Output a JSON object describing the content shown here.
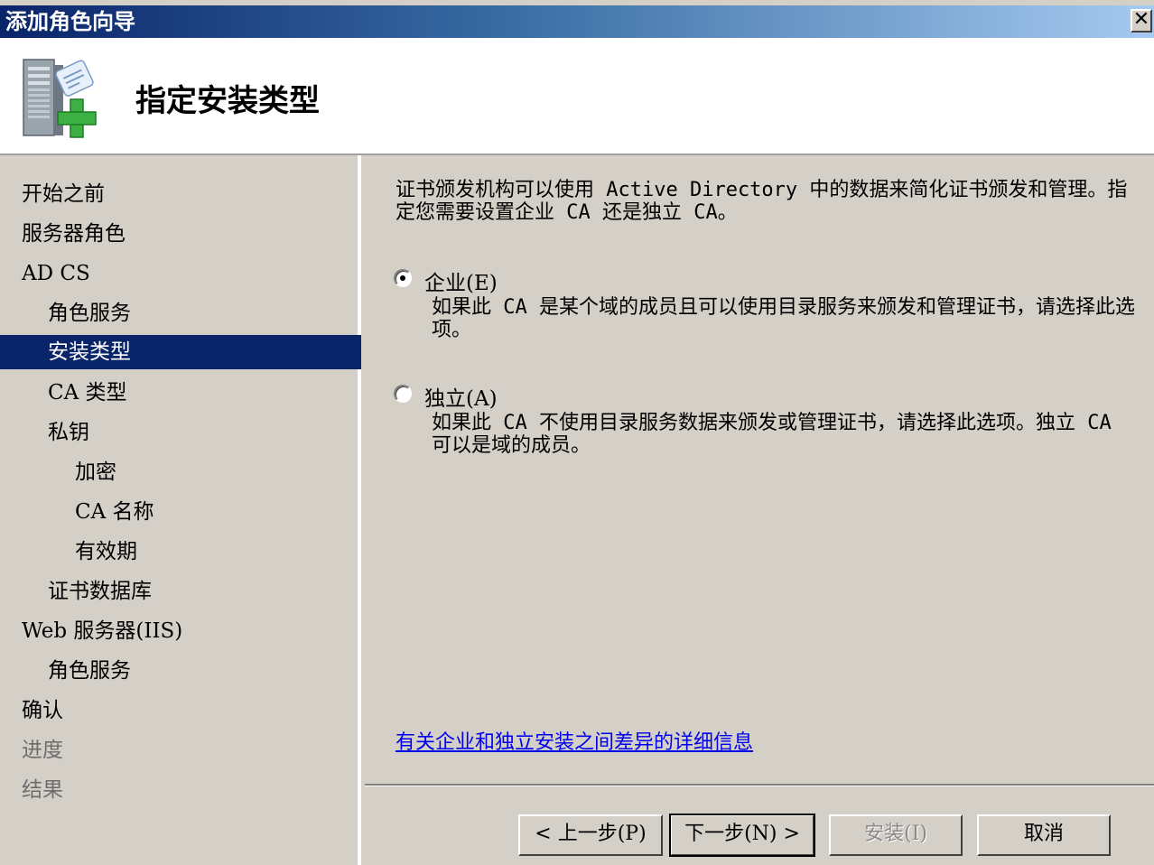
{
  "window": {
    "title": "添加角色向导",
    "close_glyph": "✕"
  },
  "header": {
    "title": "指定安装类型",
    "icon": "server-add-icon"
  },
  "sidebar": {
    "items": [
      {
        "label": "开始之前",
        "state": "normal"
      },
      {
        "label": "服务器角色",
        "state": "normal"
      },
      {
        "label": "AD CS",
        "state": "normal"
      },
      {
        "label": "角色服务",
        "state": "normal"
      },
      {
        "label": "安装类型",
        "state": "selected"
      },
      {
        "label": "CA 类型",
        "state": "normal"
      },
      {
        "label": "私钥",
        "state": "normal"
      },
      {
        "label": "加密",
        "state": "normal"
      },
      {
        "label": "CA 名称",
        "state": "normal"
      },
      {
        "label": "有效期",
        "state": "normal"
      },
      {
        "label": "证书数据库",
        "state": "normal"
      },
      {
        "label": "Web 服务器(IIS)",
        "state": "normal"
      },
      {
        "label": "角色服务",
        "state": "normal"
      },
      {
        "label": "确认",
        "state": "normal"
      },
      {
        "label": "进度",
        "state": "disabled"
      },
      {
        "label": "结果",
        "state": "disabled"
      }
    ]
  },
  "content": {
    "intro": "证书颁发机构可以使用 Active Directory 中的数据来简化证书颁发和管理。指定您需要设置企业 CA 还是独立 CA。",
    "options": [
      {
        "label": "企业(E)",
        "description": "如果此 CA 是某个域的成员且可以使用目录服务来颁发和管理证书，请选择此选项。",
        "selected": true
      },
      {
        "label": "独立(A)",
        "description": "如果此 CA 不使用目录服务数据来颁发或管理证书，请选择此选项。独立 CA 可以是域的成员。",
        "selected": false
      }
    ],
    "more_info_link": "有关企业和独立安装之间差异的详细信息"
  },
  "footer": {
    "back": "< 上一步(P)",
    "next": "下一步(N) >",
    "install": "安装(I)",
    "cancel": "取消"
  },
  "colors": {
    "selection": "#0a246a",
    "link": "#0000ee",
    "face": "#d4d0c8"
  }
}
